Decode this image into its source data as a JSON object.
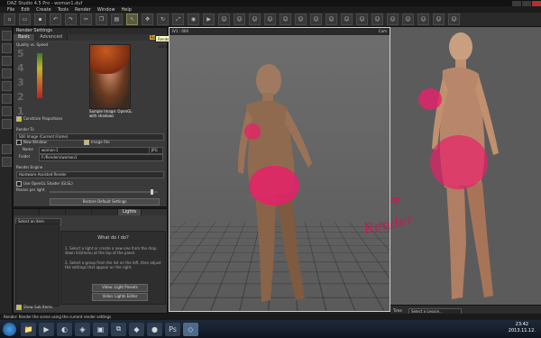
{
  "window": {
    "title": "DAZ Studio 4.5 Pro - woman1.duf"
  },
  "menu": [
    "File",
    "Edit",
    "Create",
    "Tools",
    "Render",
    "Window",
    "Help"
  ],
  "toolbar_icons": [
    "new-icon",
    "open-icon",
    "save-icon",
    "undo-icon",
    "redo-icon",
    "select-icon",
    "move-icon",
    "rotate-icon",
    "scale-icon",
    "render-icon",
    "thumb-icon",
    "thumb-icon",
    "thumb-icon",
    "thumb-icon",
    "thumb-icon",
    "thumb-icon",
    "thumb-icon",
    "thumb-icon",
    "thumb-icon",
    "thumb-icon"
  ],
  "render_settings": {
    "title": "Render Settings",
    "tabs": [
      "Basic",
      "Advanced"
    ],
    "render_btn": "Render",
    "tooltip": "Render using the current settings",
    "quality_label": "Quality vs. Speed",
    "quality_numbers": [
      "5",
      "4",
      "3",
      "2",
      "1"
    ],
    "thumb_caption": "Sample Image: OpenGL with shadows",
    "constrain": "Constrain Proportions",
    "render_to_label": "Render To",
    "render_to_value": "Still Image (Current Frame)",
    "new_window": "New Window",
    "image_file": "Image File",
    "name_label": "Name",
    "name_value": "woman-1",
    "folder_label": "Folder",
    "folder_value": "F:/Renders/woman1",
    "ext_value": "JPG",
    "engine_label": "Render Engine",
    "engine_value": "Hardware Assisted Render",
    "opengl_shader": "Use OpenGL Shader (GLSL)",
    "passes": "Passes per light",
    "restore": "Restore Default Settings"
  },
  "lights_panel": {
    "tabs": [
      "Lights"
    ],
    "list_header": "Select an item",
    "what_title": "What do I do?",
    "hint1": "1. Select a light or create a new one from the drop down list/menu at the top of the panel.",
    "hint2": "2. Select a group from the list on the left, then adjust the settings that appear on the right.",
    "btn1": "Video: Light Presets",
    "btn2": "Video: Lights Editor",
    "show_sub": "Show Sub Items"
  },
  "viewport": {
    "label": "IV1 : 000",
    "title": "Cam"
  },
  "render": {
    "annotation": "Render"
  },
  "status": "Render: Render the scene using the current render settings",
  "timeline": {
    "label": "Time",
    "lesson": "Select a Lesson..."
  },
  "taskbar": {
    "apps": [
      "folder-icon",
      "media-icon",
      "firefox-icon",
      "app-icon",
      "app-icon",
      "app-icon",
      "app-icon",
      "app-icon",
      "photoshop-icon",
      "daz-icon"
    ],
    "time": "23:42",
    "date": "2013.11.12."
  }
}
